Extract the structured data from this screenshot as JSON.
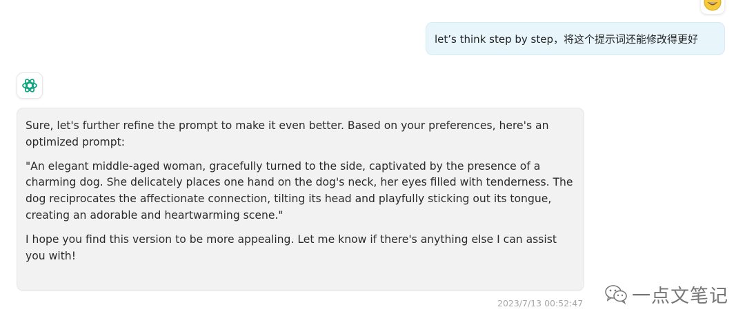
{
  "conversation": {
    "user_message": {
      "text": "let’s think step by step，将这个提示词还能修改得更好",
      "avatar_icon": "smiley-face-icon"
    },
    "assistant_message": {
      "avatar_icon": "chatgpt-logo-icon",
      "paragraphs": [
        "Sure, let's further refine the prompt to make it even better. Based on your preferences, here's an optimized prompt:",
        "\"An elegant middle-aged woman, gracefully turned to the side, captivated by the presence of a charming dog. She delicately places one hand on the dog's neck, her eyes filled with tenderness. The dog reciprocates the affectionate connection, tilting its head and playfully sticking out its tongue, creating an adorable and heartwarming scene.\"",
        "I hope you find this version to be more appealing. Let me know if there's anything else I can assist you with!"
      ],
      "timestamp": "2023/7/13 00:52:47"
    }
  },
  "watermark": {
    "text": "一点文笔记",
    "icon": "wechat-icon"
  },
  "colors": {
    "user_bubble_bg": "#e8f6fb",
    "assistant_bubble_bg": "#f2f2f2",
    "logo_teal": "#10a37f",
    "avatar_yellow": "#f5c93a"
  }
}
